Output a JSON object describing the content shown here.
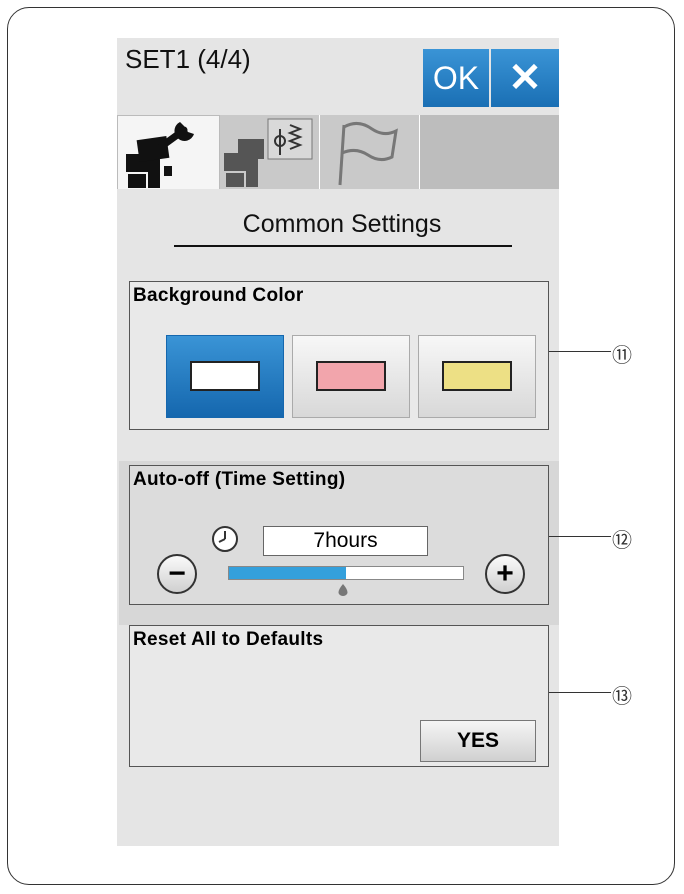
{
  "header": {
    "title": "SET1 (4/4)",
    "ok_label": "OK",
    "close_label": "✕"
  },
  "tabs": [
    {
      "icon": "machine-wrench-icon",
      "active": true
    },
    {
      "icon": "machine-stitch-icon",
      "active": false
    },
    {
      "icon": "flag-icon",
      "active": false
    }
  ],
  "section": {
    "title": "Common Settings"
  },
  "background_color": {
    "label": "Background Color",
    "options": [
      {
        "color": "#ffffff",
        "selected": true
      },
      {
        "color": "#f2a5ac",
        "selected": false
      },
      {
        "color": "#ede085",
        "selected": false
      }
    ]
  },
  "auto_off": {
    "label": "Auto-off (Time Setting)",
    "value": "7hours",
    "slider_fraction": 0.5,
    "minus_label": "−",
    "plus_label": "+"
  },
  "reset": {
    "label": "Reset All to Defaults",
    "yes_label": "YES"
  },
  "callouts": [
    "⑪",
    "⑫",
    "⑬"
  ],
  "colors": {
    "accent": "#1a6fb4",
    "slider": "#34a0dc"
  }
}
